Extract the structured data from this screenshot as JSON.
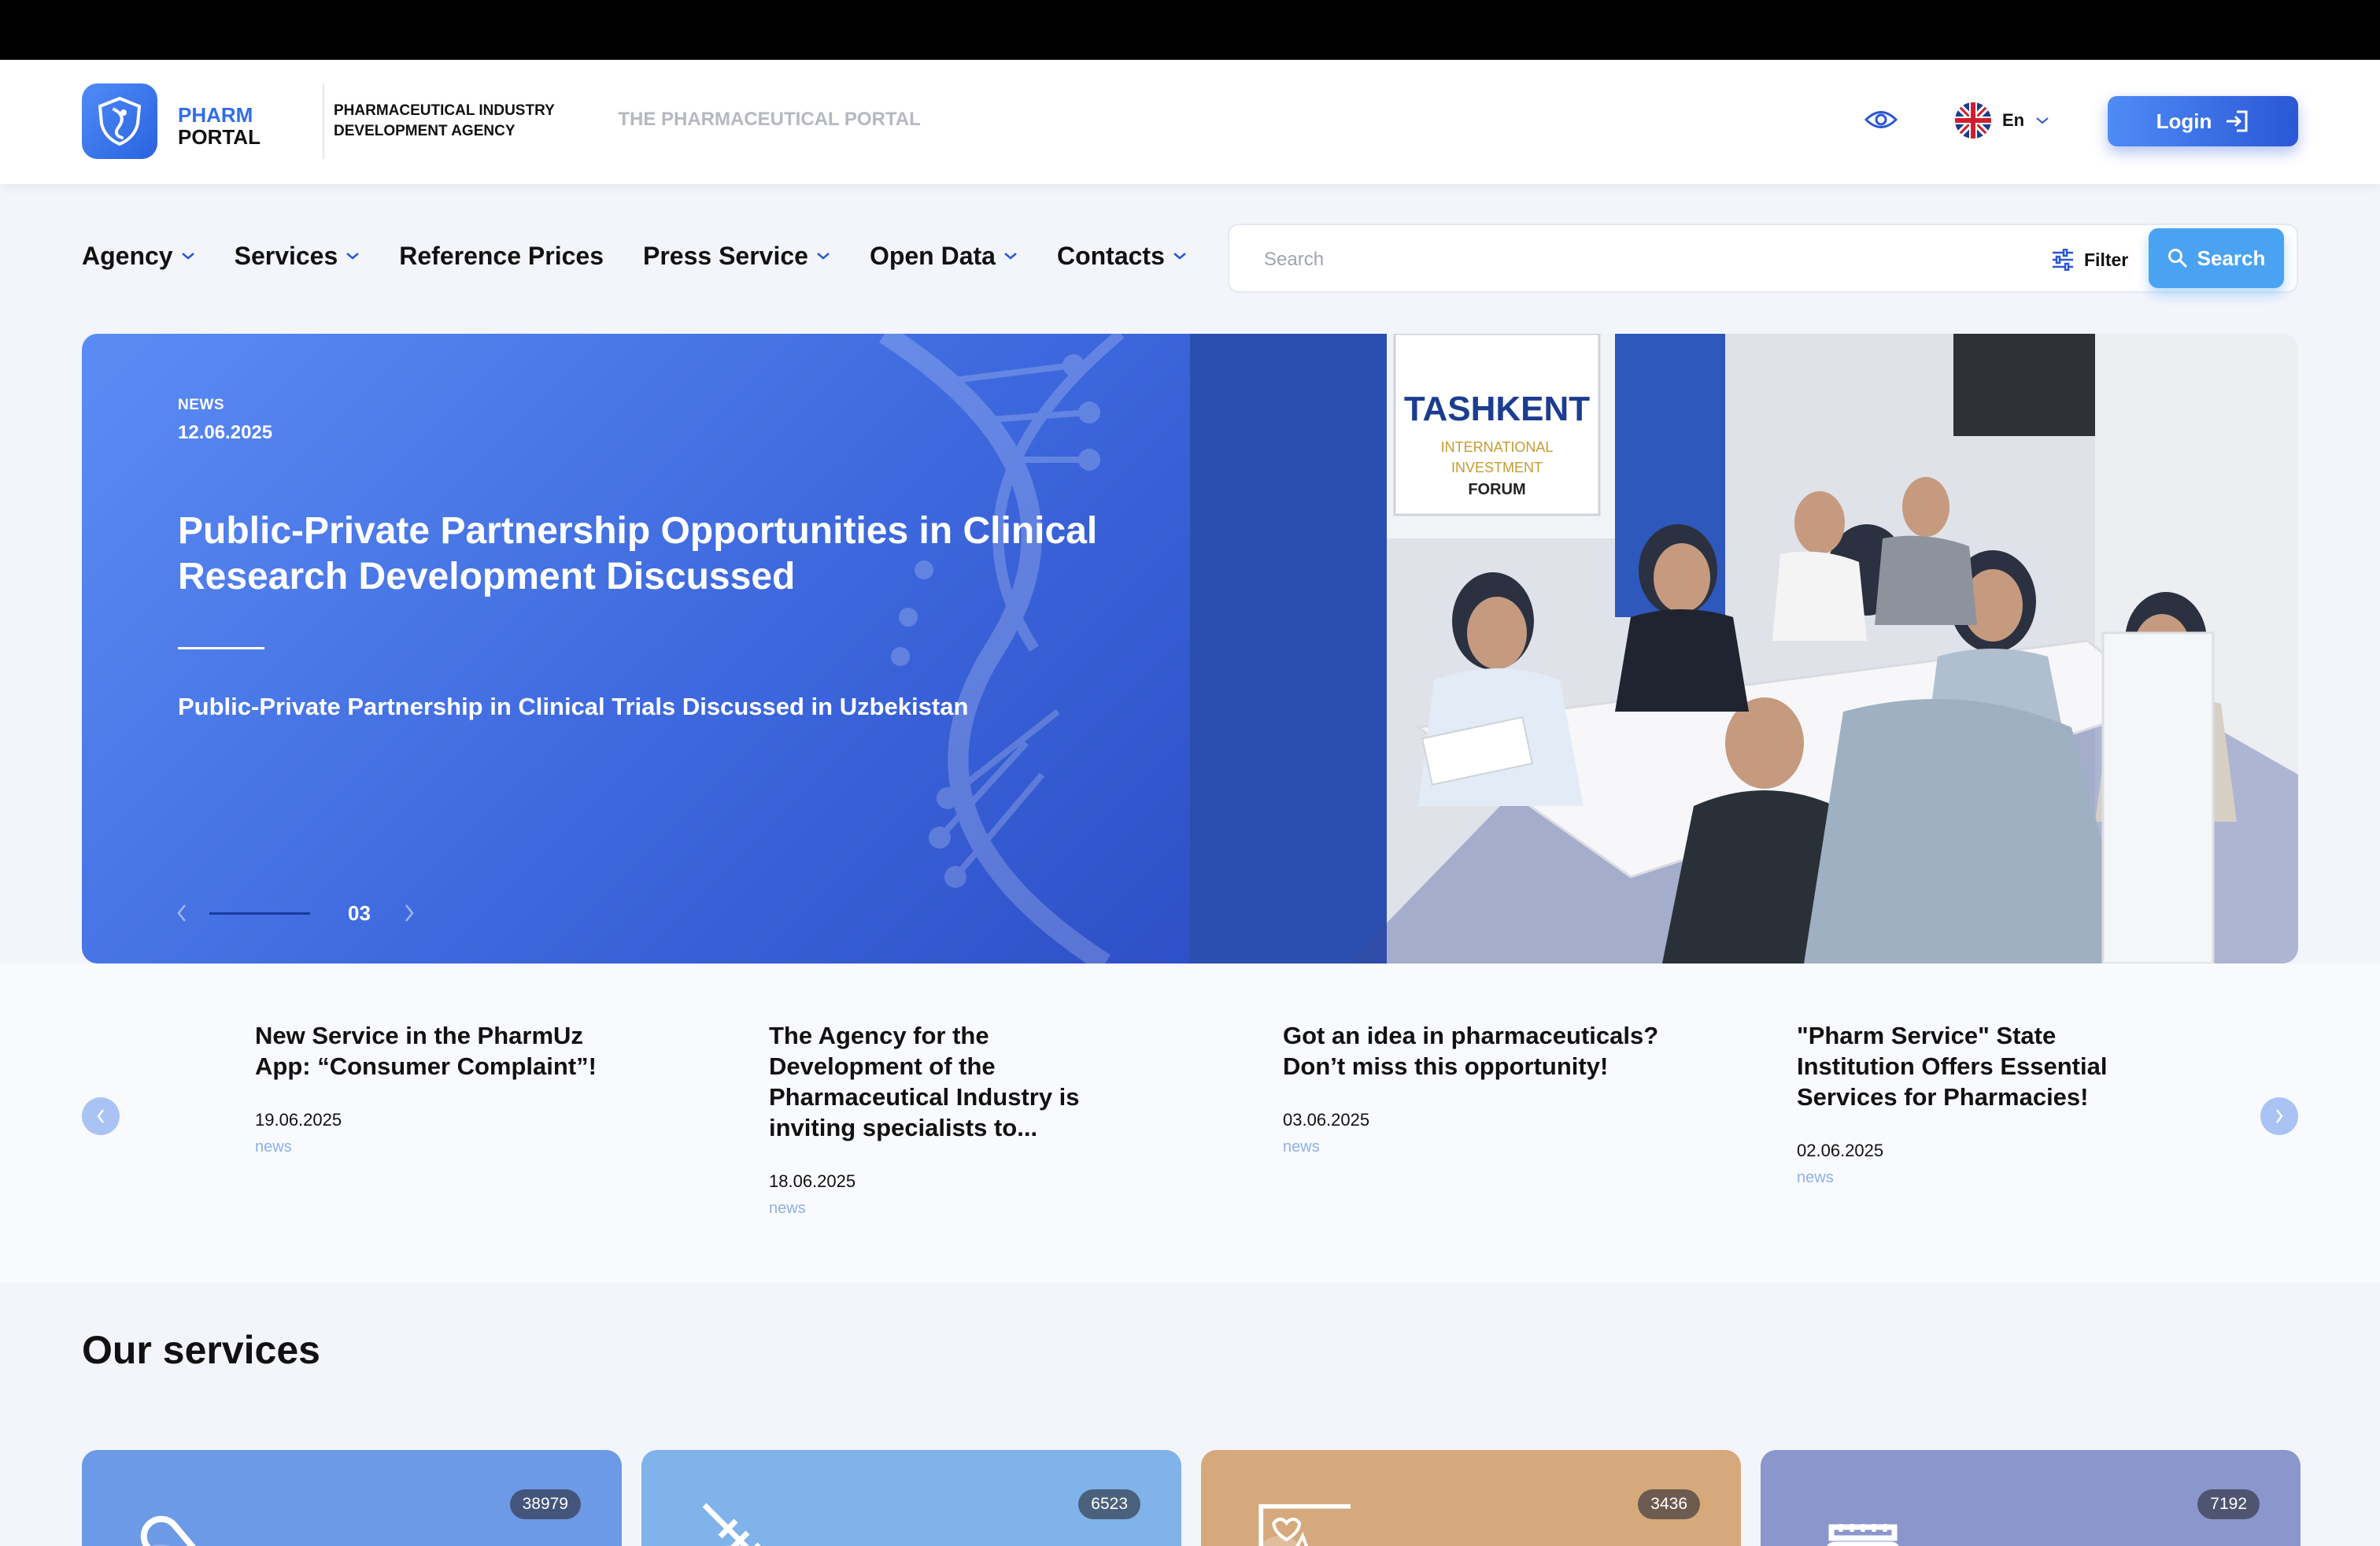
{
  "header": {
    "logo_line1": "PHARM",
    "logo_line2": "PORTAL",
    "agency_line1": "PHARMACEUTICAL INDUSTRY",
    "agency_line2": "DEVELOPMENT AGENCY",
    "marquee_text": "O THE PHARMACEUTICAL PORTAL",
    "language": "En",
    "login_label": "Login"
  },
  "nav": {
    "items": [
      {
        "label": "Agency",
        "has_dropdown": true
      },
      {
        "label": "Services",
        "has_dropdown": true
      },
      {
        "label": "Reference Prices",
        "has_dropdown": false
      },
      {
        "label": "Press Service",
        "has_dropdown": true
      },
      {
        "label": "Open Data",
        "has_dropdown": true
      },
      {
        "label": "Contacts",
        "has_dropdown": true
      }
    ]
  },
  "search": {
    "placeholder": "Search",
    "value": "",
    "filter_label": "Filter",
    "button_label": "Search"
  },
  "hero": {
    "tag": "NEWS",
    "date": "12.06.2025",
    "title": "Public-Private Partnership Opportunities in Clinical Research Development Discussed",
    "subtitle": "Public-Private Partnership in Clinical Trials Discussed in Uzbekistan",
    "slide_number": "03",
    "photo_sign_line1": "TASHKENT",
    "photo_sign_line2": "INTERNATIONAL",
    "photo_sign_line3": "INVESTMENT",
    "photo_sign_line4": "FORUM"
  },
  "news": [
    {
      "title": "New Service in the PharmUz App: “Consumer Complaint”!",
      "date": "19.06.2025",
      "category": "news"
    },
    {
      "title": "The Agency for the Development of the Pharmaceutical Industry is inviting specialists to...",
      "date": "18.06.2025",
      "category": "news"
    },
    {
      "title": "Got an idea in pharmaceuticals? Don’t miss this opportunity!",
      "date": "03.06.2025",
      "category": "news"
    },
    {
      "title": "\"Pharm Service\" State Institution Offers Essential Services for Pharmacies!",
      "date": "02.06.2025",
      "category": "news"
    }
  ],
  "services": {
    "title": "Our services",
    "cards": [
      {
        "count": "38979",
        "icon": "pill-icon",
        "color": "#6c9ae6"
      },
      {
        "count": "6523",
        "icon": "syringe-icon",
        "color": "#7fb3ea"
      },
      {
        "count": "3436",
        "icon": "heart-monitor-icon",
        "color": "#d6a97c"
      },
      {
        "count": "7192",
        "icon": "medicine-jar-icon",
        "color": "#8b97cc"
      }
    ]
  }
}
